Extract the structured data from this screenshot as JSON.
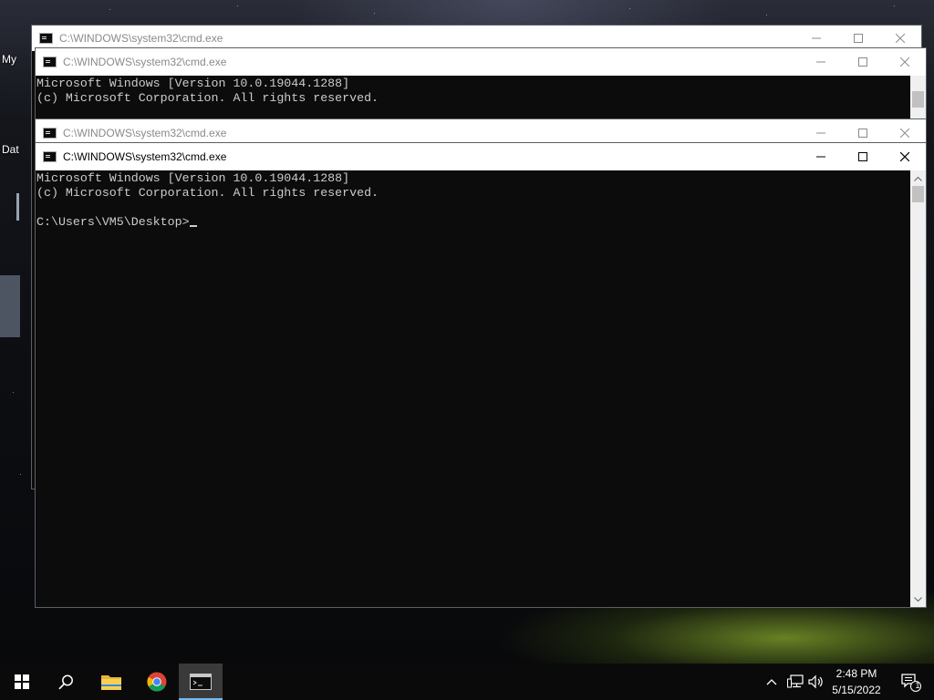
{
  "desktop": {
    "icon_labels": [
      "My",
      "Dat"
    ]
  },
  "windows": [
    {
      "title": "C:\\WINDOWS\\system32\\cmd.exe",
      "lines": []
    },
    {
      "title": "C:\\WINDOWS\\system32\\cmd.exe",
      "lines": [
        "Microsoft Windows [Version 10.0.19044.1288]",
        "(c) Microsoft Corporation. All rights reserved."
      ]
    },
    {
      "title": "C:\\WINDOWS\\system32\\cmd.exe",
      "lines": []
    },
    {
      "title": "C:\\WINDOWS\\system32\\cmd.exe",
      "lines": [
        "Microsoft Windows [Version 10.0.19044.1288]",
        "(c) Microsoft Corporation. All rights reserved.",
        "",
        "C:\\Users\\VM5\\Desktop>"
      ]
    }
  ],
  "taskbar": {
    "apps": [
      "start-icon",
      "search-icon",
      "file-explorer-icon",
      "chrome-icon",
      "command-prompt-icon"
    ],
    "active_app": "command-prompt-icon",
    "tray_icons": [
      "chevron-up-icon",
      "network-icon",
      "volume-icon"
    ],
    "time": "2:48 PM",
    "date": "5/15/2022",
    "notification_count": "1"
  },
  "colors": {
    "console_bg": "#0c0c0c",
    "console_text": "#cccccc",
    "taskbar_bg": "#0a0a0a",
    "accent": "#76b9ed"
  }
}
